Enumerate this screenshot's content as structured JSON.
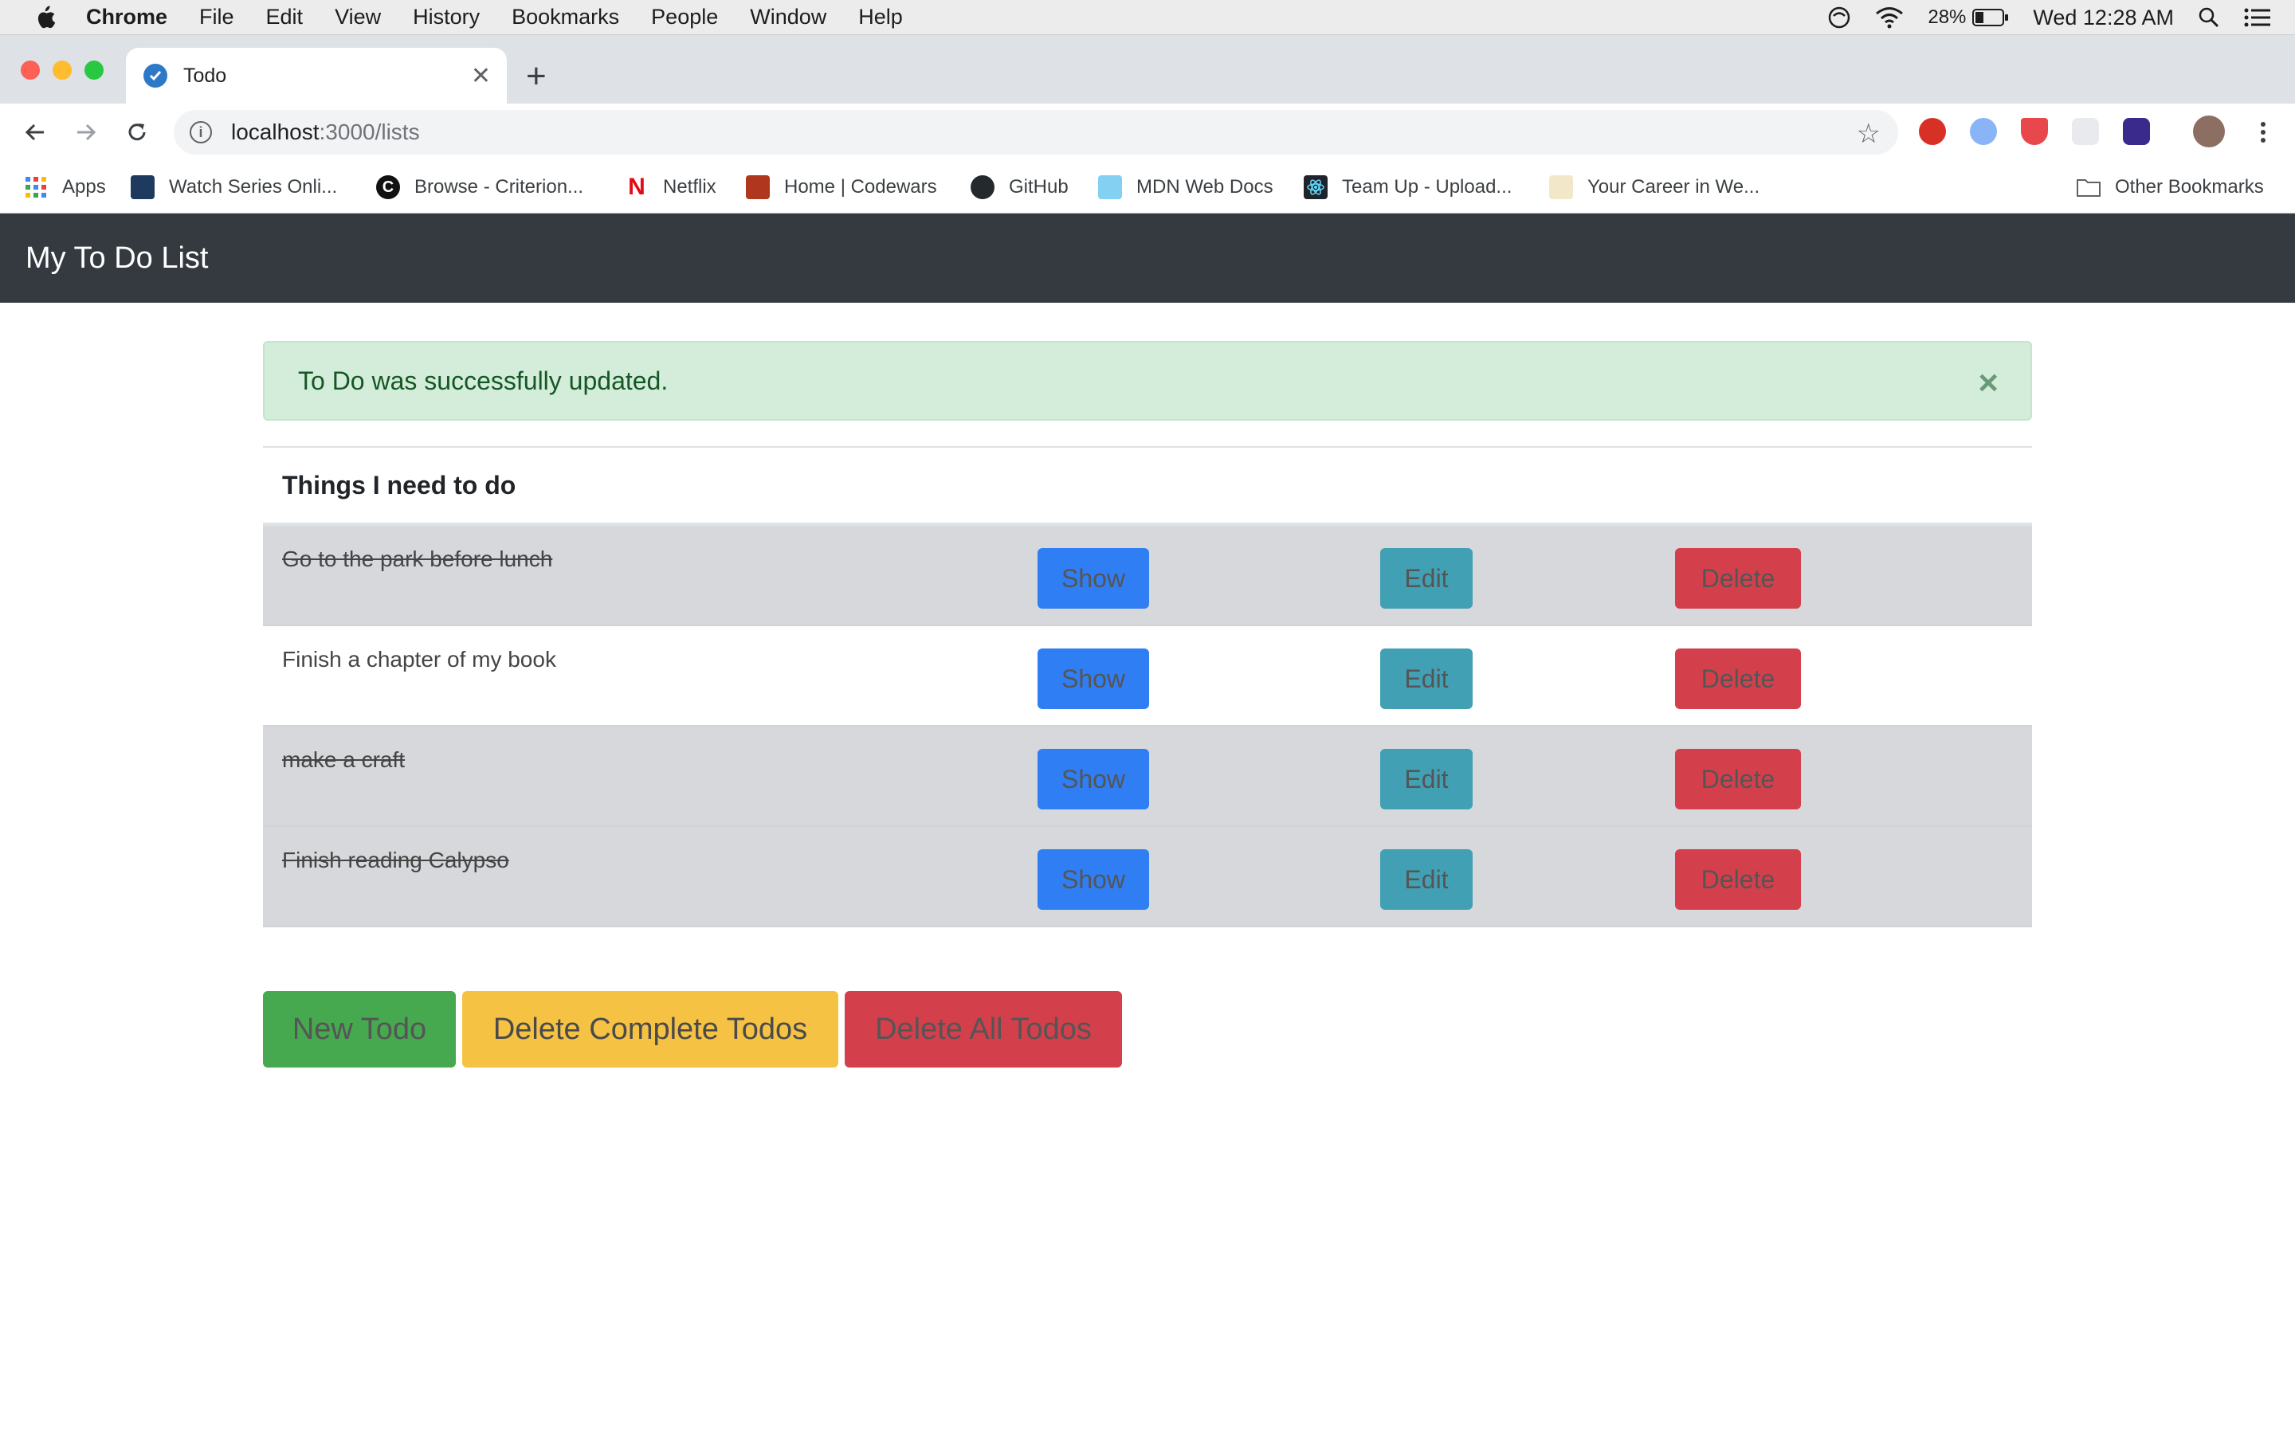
{
  "menubar": {
    "app_name": "Chrome",
    "items": [
      "File",
      "Edit",
      "View",
      "History",
      "Bookmarks",
      "People",
      "Window",
      "Help"
    ],
    "battery": "28%",
    "clock": "Wed 12:28 AM"
  },
  "browser": {
    "tab_title": "Todo",
    "url_host": "localhost",
    "url_rest": ":3000/lists",
    "bookmarks": [
      "Apps",
      "Watch Series Onli...",
      "Browse - Criterion...",
      "Netflix",
      "Home | Codewars",
      "GitHub",
      "MDN Web Docs",
      "Team Up - Upload...",
      "Your Career in We..."
    ],
    "other_bookmarks": "Other Bookmarks"
  },
  "page": {
    "brand": "My To Do List",
    "alert": "To Do was successfully updated.",
    "alert_close": "×",
    "table_header": "Things I need to do",
    "todos": [
      {
        "text": "Go to the park before lunch",
        "done": true
      },
      {
        "text": "Finish a chapter of my book",
        "done": false
      },
      {
        "text": "make a craft",
        "done": true
      },
      {
        "text": "Finish reading Calypso",
        "done": true
      }
    ],
    "row_buttons": {
      "show": "Show",
      "edit": "Edit",
      "delete": "Delete"
    },
    "actions": {
      "new": "New Todo",
      "delete_complete": "Delete Complete Todos",
      "delete_all": "Delete All Todos"
    }
  },
  "colors": {
    "navbar": "#343a40",
    "alert_bg": "#d4edda",
    "show": "#2f7ef4",
    "edit": "#42a0b5",
    "delete": "#d43f4c",
    "new": "#46a84f",
    "delete_complete": "#f6c244"
  }
}
